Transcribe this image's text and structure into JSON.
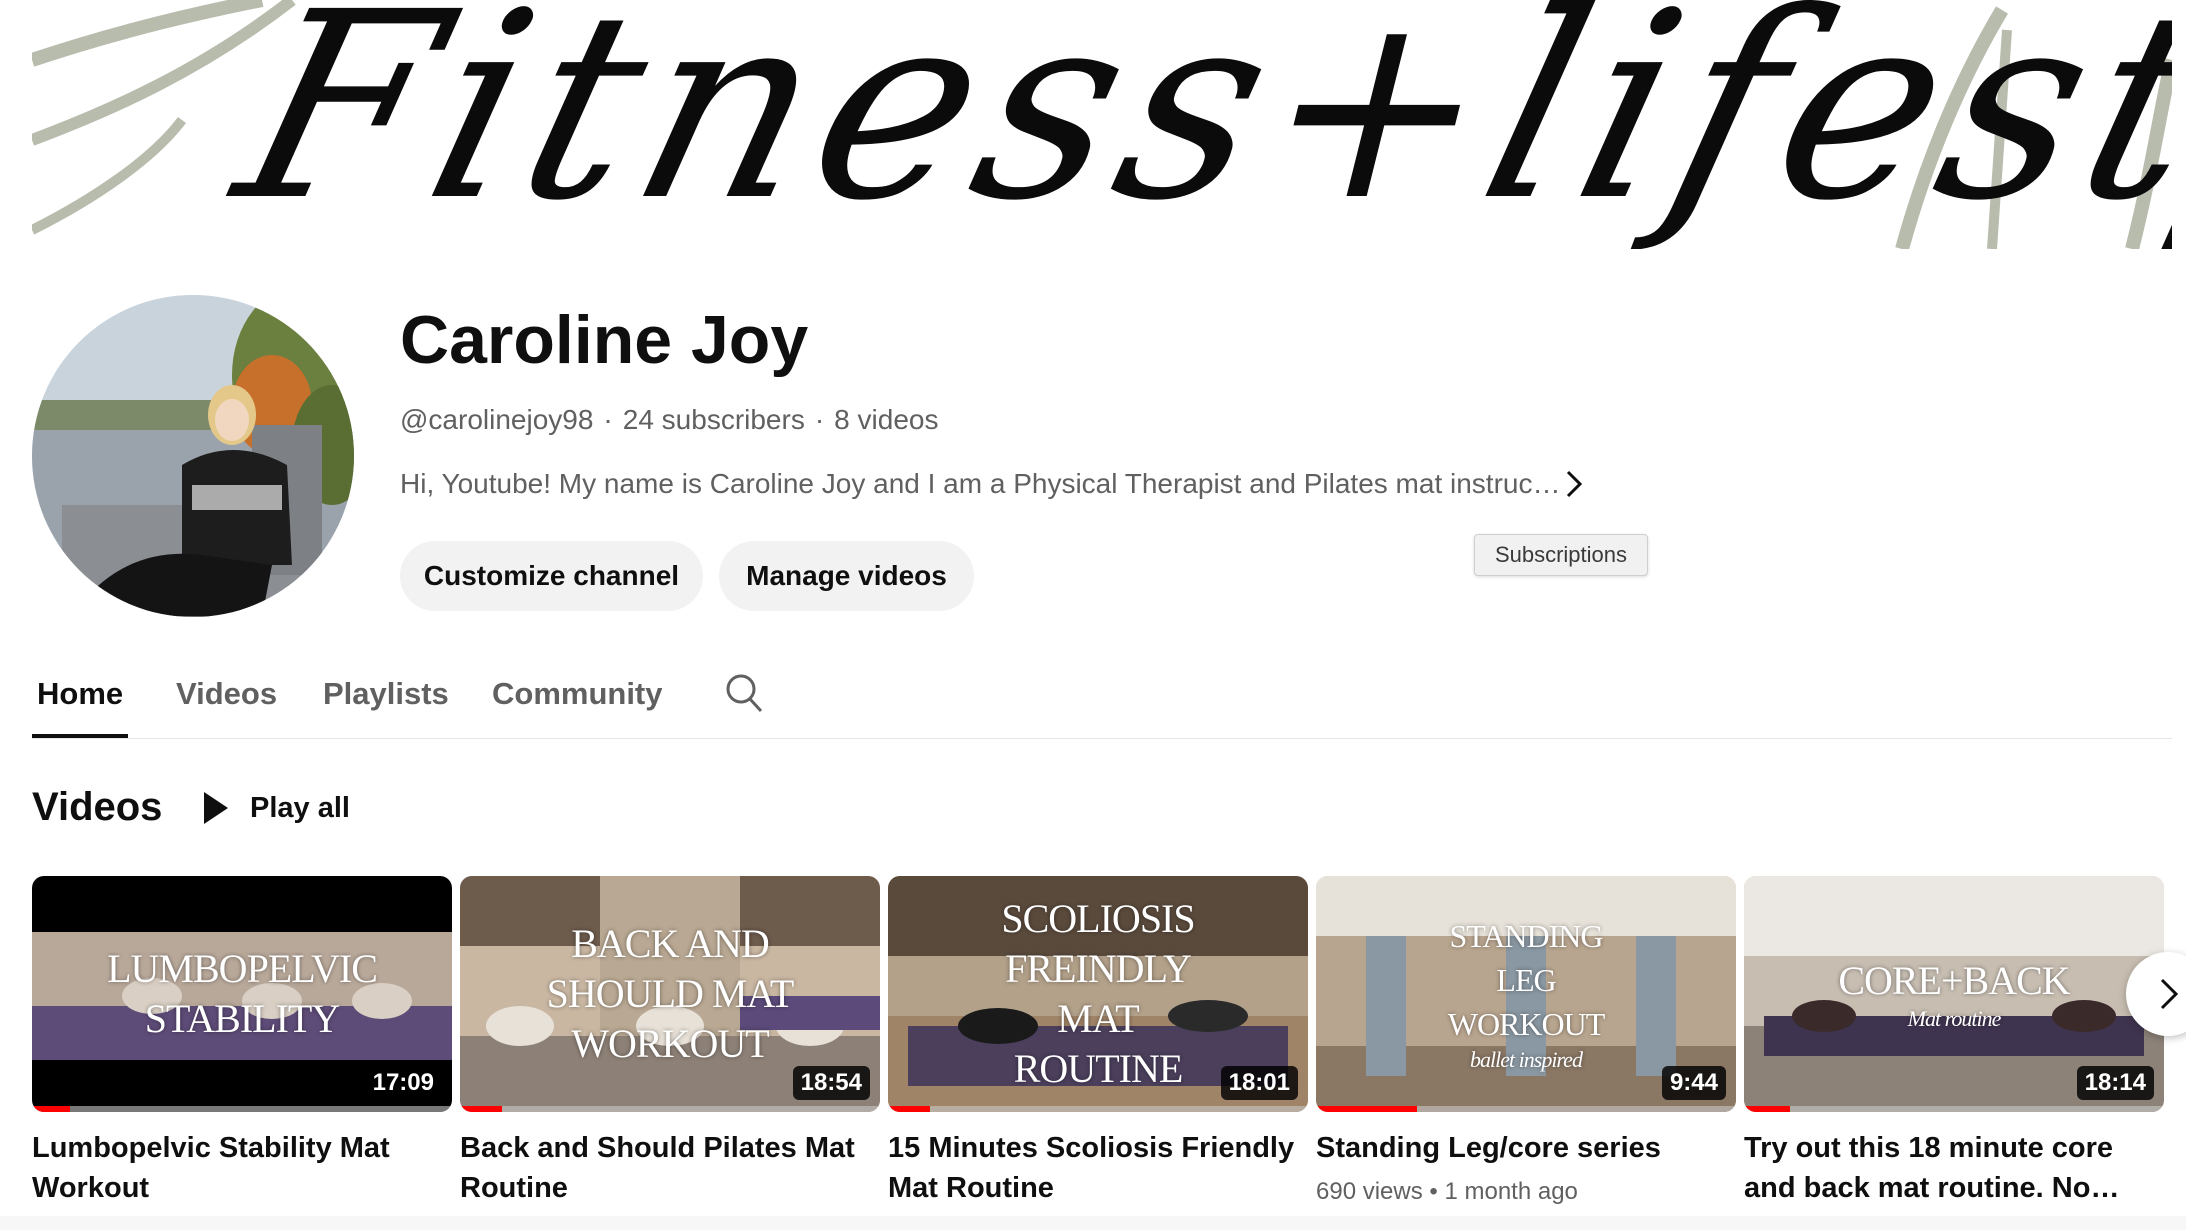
{
  "banner": {
    "text": "Fitness+lifestyle",
    "accent_color": "#b8bcad"
  },
  "channel": {
    "name": "Caroline Joy",
    "handle": "@carolinejoy98",
    "subscribers": "24 subscribers",
    "video_count": "8 videos",
    "separator": "·",
    "description": "Hi, Youtube! My name is Caroline Joy and I am a Physical Therapist and Pilates mat instruc…",
    "more_icon": "chevron-right-icon"
  },
  "actions": {
    "customize": "Customize channel",
    "manage": "Manage videos"
  },
  "tooltip": {
    "text": "Subscriptions"
  },
  "tabs": [
    {
      "label": "Home",
      "active": true
    },
    {
      "label": "Videos",
      "active": false
    },
    {
      "label": "Playlists",
      "active": false
    },
    {
      "label": "Community",
      "active": false
    }
  ],
  "search_icon": "search-icon",
  "videos_section": {
    "title": "Videos",
    "play_all": "Play all",
    "items": [
      {
        "thumb_lines": [
          "LUMBOPELVIC",
          "STABILITY"
        ],
        "duration": "17:09",
        "title": "Lumbopelvic Stability Mat Workout",
        "watched": 0.09,
        "meta": ""
      },
      {
        "thumb_lines": [
          "BACK AND",
          "SHOULD MAT",
          "WORKOUT"
        ],
        "duration": "18:54",
        "title": "Back and Should Pilates Mat Routine",
        "watched": 0.1,
        "meta": ""
      },
      {
        "thumb_lines": [
          "SCOLIOSIS",
          "FREINDLY",
          "MAT",
          "ROUTINE"
        ],
        "duration": "18:01",
        "title": "15 Minutes Scoliosis Friendly Mat Routine",
        "watched": 0.1,
        "meta": ""
      },
      {
        "thumb_lines": [
          "STANDING",
          "LEG",
          "WORKOUT",
          "ballet inspired"
        ],
        "duration": "9:44",
        "title": "Standing Leg/core series",
        "watched": 0.24,
        "meta": "690 views • 1 month ago"
      },
      {
        "thumb_lines": [
          "CORE+BACK",
          "Mat routine"
        ],
        "duration": "18:14",
        "title": "Try out this 18 minute core and back mat routine. No…",
        "watched": 0.11,
        "meta": ""
      }
    ]
  },
  "next_icon": "chevron-right-icon"
}
